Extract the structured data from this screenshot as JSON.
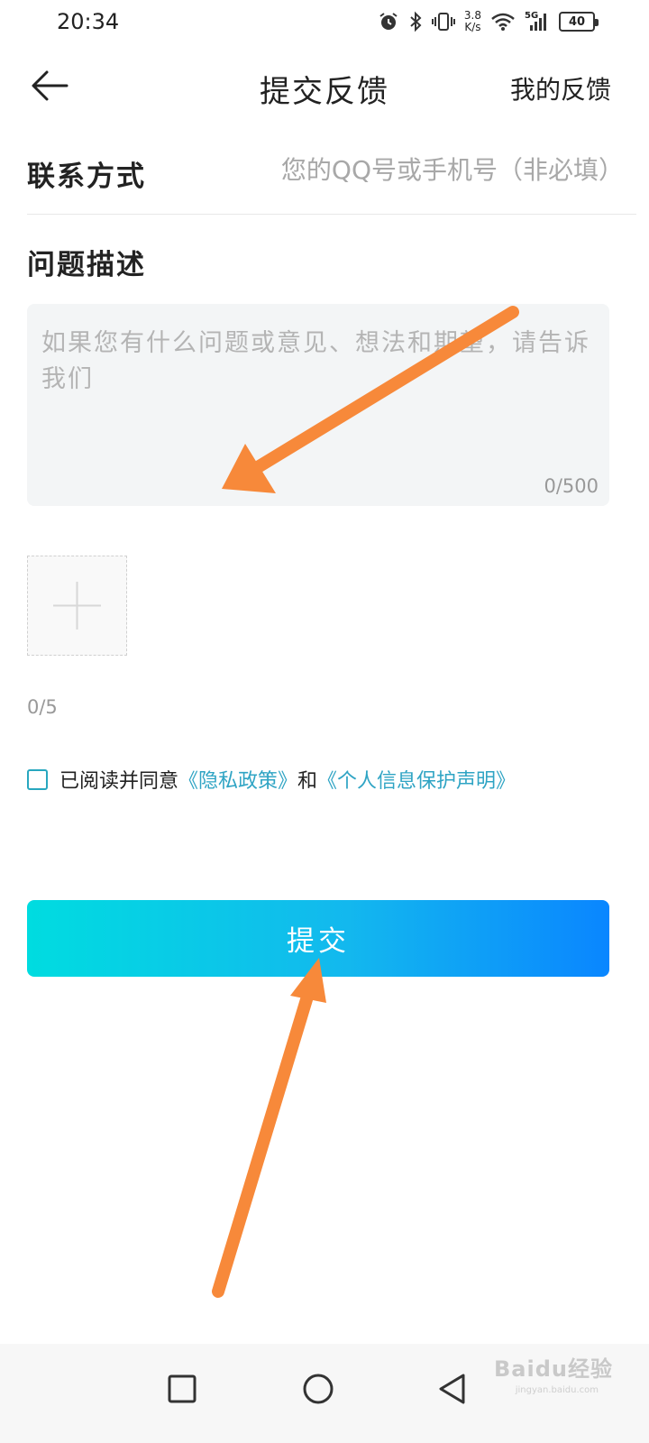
{
  "status_bar": {
    "time": "20:34",
    "net_speed_value": "3.8",
    "net_speed_unit": "K/s",
    "network_type": "5G",
    "battery": "40",
    "icons": [
      "alarm-icon",
      "bluetooth-icon",
      "vibrate-icon",
      "wifi-icon",
      "signal-icon",
      "battery-icon"
    ]
  },
  "header": {
    "back_icon": "arrow-left-icon",
    "title": "提交反馈",
    "my_feedback": "我的反馈"
  },
  "contact": {
    "label": "联系方式",
    "value": "",
    "placeholder": "您的QQ号或手机号（非必填）"
  },
  "description": {
    "label": "问题描述",
    "value": "",
    "placeholder": "如果您有什么问题或意见、想法和期望，请告诉我们",
    "counter": "0/500"
  },
  "attachments": {
    "add_icon": "plus-icon",
    "counter": "0/5"
  },
  "agreement": {
    "checked": false,
    "text_prefix": "已阅读并同意",
    "privacy_link": "《隐私政策》",
    "conjunction": "和",
    "personal_info_link": "《个人信息保护声明》"
  },
  "submit": {
    "label": "提交"
  },
  "nav_bar": {
    "icons": [
      "recent-apps-icon",
      "home-icon",
      "back-icon"
    ]
  },
  "watermark": {
    "text": "Baidu经验",
    "sub": "jingyan.baidu.com"
  },
  "colors": {
    "accent_link": "#2fa4c4",
    "button_gradient_start": "#00dce0",
    "button_gradient_end": "#0a86ff",
    "annotation_arrow": "#f7893a"
  }
}
